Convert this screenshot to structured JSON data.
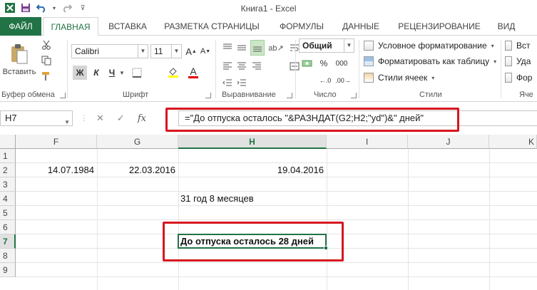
{
  "window": {
    "title": "Книга1 - Excel"
  },
  "ribbon_tabs": [
    "ФАЙЛ",
    "ГЛАВНАЯ",
    "ВСТАВКА",
    "РАЗМЕТКА СТРАНИЦЫ",
    "ФОРМУЛЫ",
    "ДАННЫЕ",
    "РЕЦЕНЗИРОВАНИЕ",
    "ВИД"
  ],
  "clipboard": {
    "paste_label": "Вставить",
    "group_label": "Буфер обмена"
  },
  "font": {
    "name": "Calibri",
    "size": "11",
    "bold": "Ж",
    "italic": "К",
    "underline": "Ч",
    "font_color_glyph": "A",
    "group_label": "Шрифт"
  },
  "alignment": {
    "group_label": "Выравнивание"
  },
  "number": {
    "format": "Общий",
    "percent": "%",
    "thousands": "000",
    "group_label": "Число"
  },
  "styles": {
    "conditional": "Условное форматирование",
    "as_table": "Форматировать как таблицу",
    "cell_styles": "Стили ячеек",
    "group_label": "Стили"
  },
  "cells_group": {
    "insert": "Вст",
    "delete": "Уда",
    "format": "Фор",
    "group_label": "Яче"
  },
  "formula_bar": {
    "name_box": "H7",
    "fx": "fx",
    "formula": "=\"До отпуска осталось \"&РАЗНДАТ(G2;H2;\"yd\")&\" дней\""
  },
  "grid": {
    "columns": [
      "F",
      "G",
      "H",
      "I",
      "J",
      "K"
    ],
    "selected_column": "H",
    "rows": [
      "1",
      "2",
      "3",
      "4",
      "5",
      "6",
      "7",
      "8",
      "9"
    ],
    "selected_row": "7",
    "values": {
      "F2": "14.07.1984",
      "G2": "22.03.2016",
      "H2": "19.04.2016",
      "H4": "31 год 8 месяцев",
      "H7": "До отпуска осталось 28 дней"
    }
  },
  "colors": {
    "excel_green": "#217346",
    "highlight_red": "#d7161f"
  }
}
